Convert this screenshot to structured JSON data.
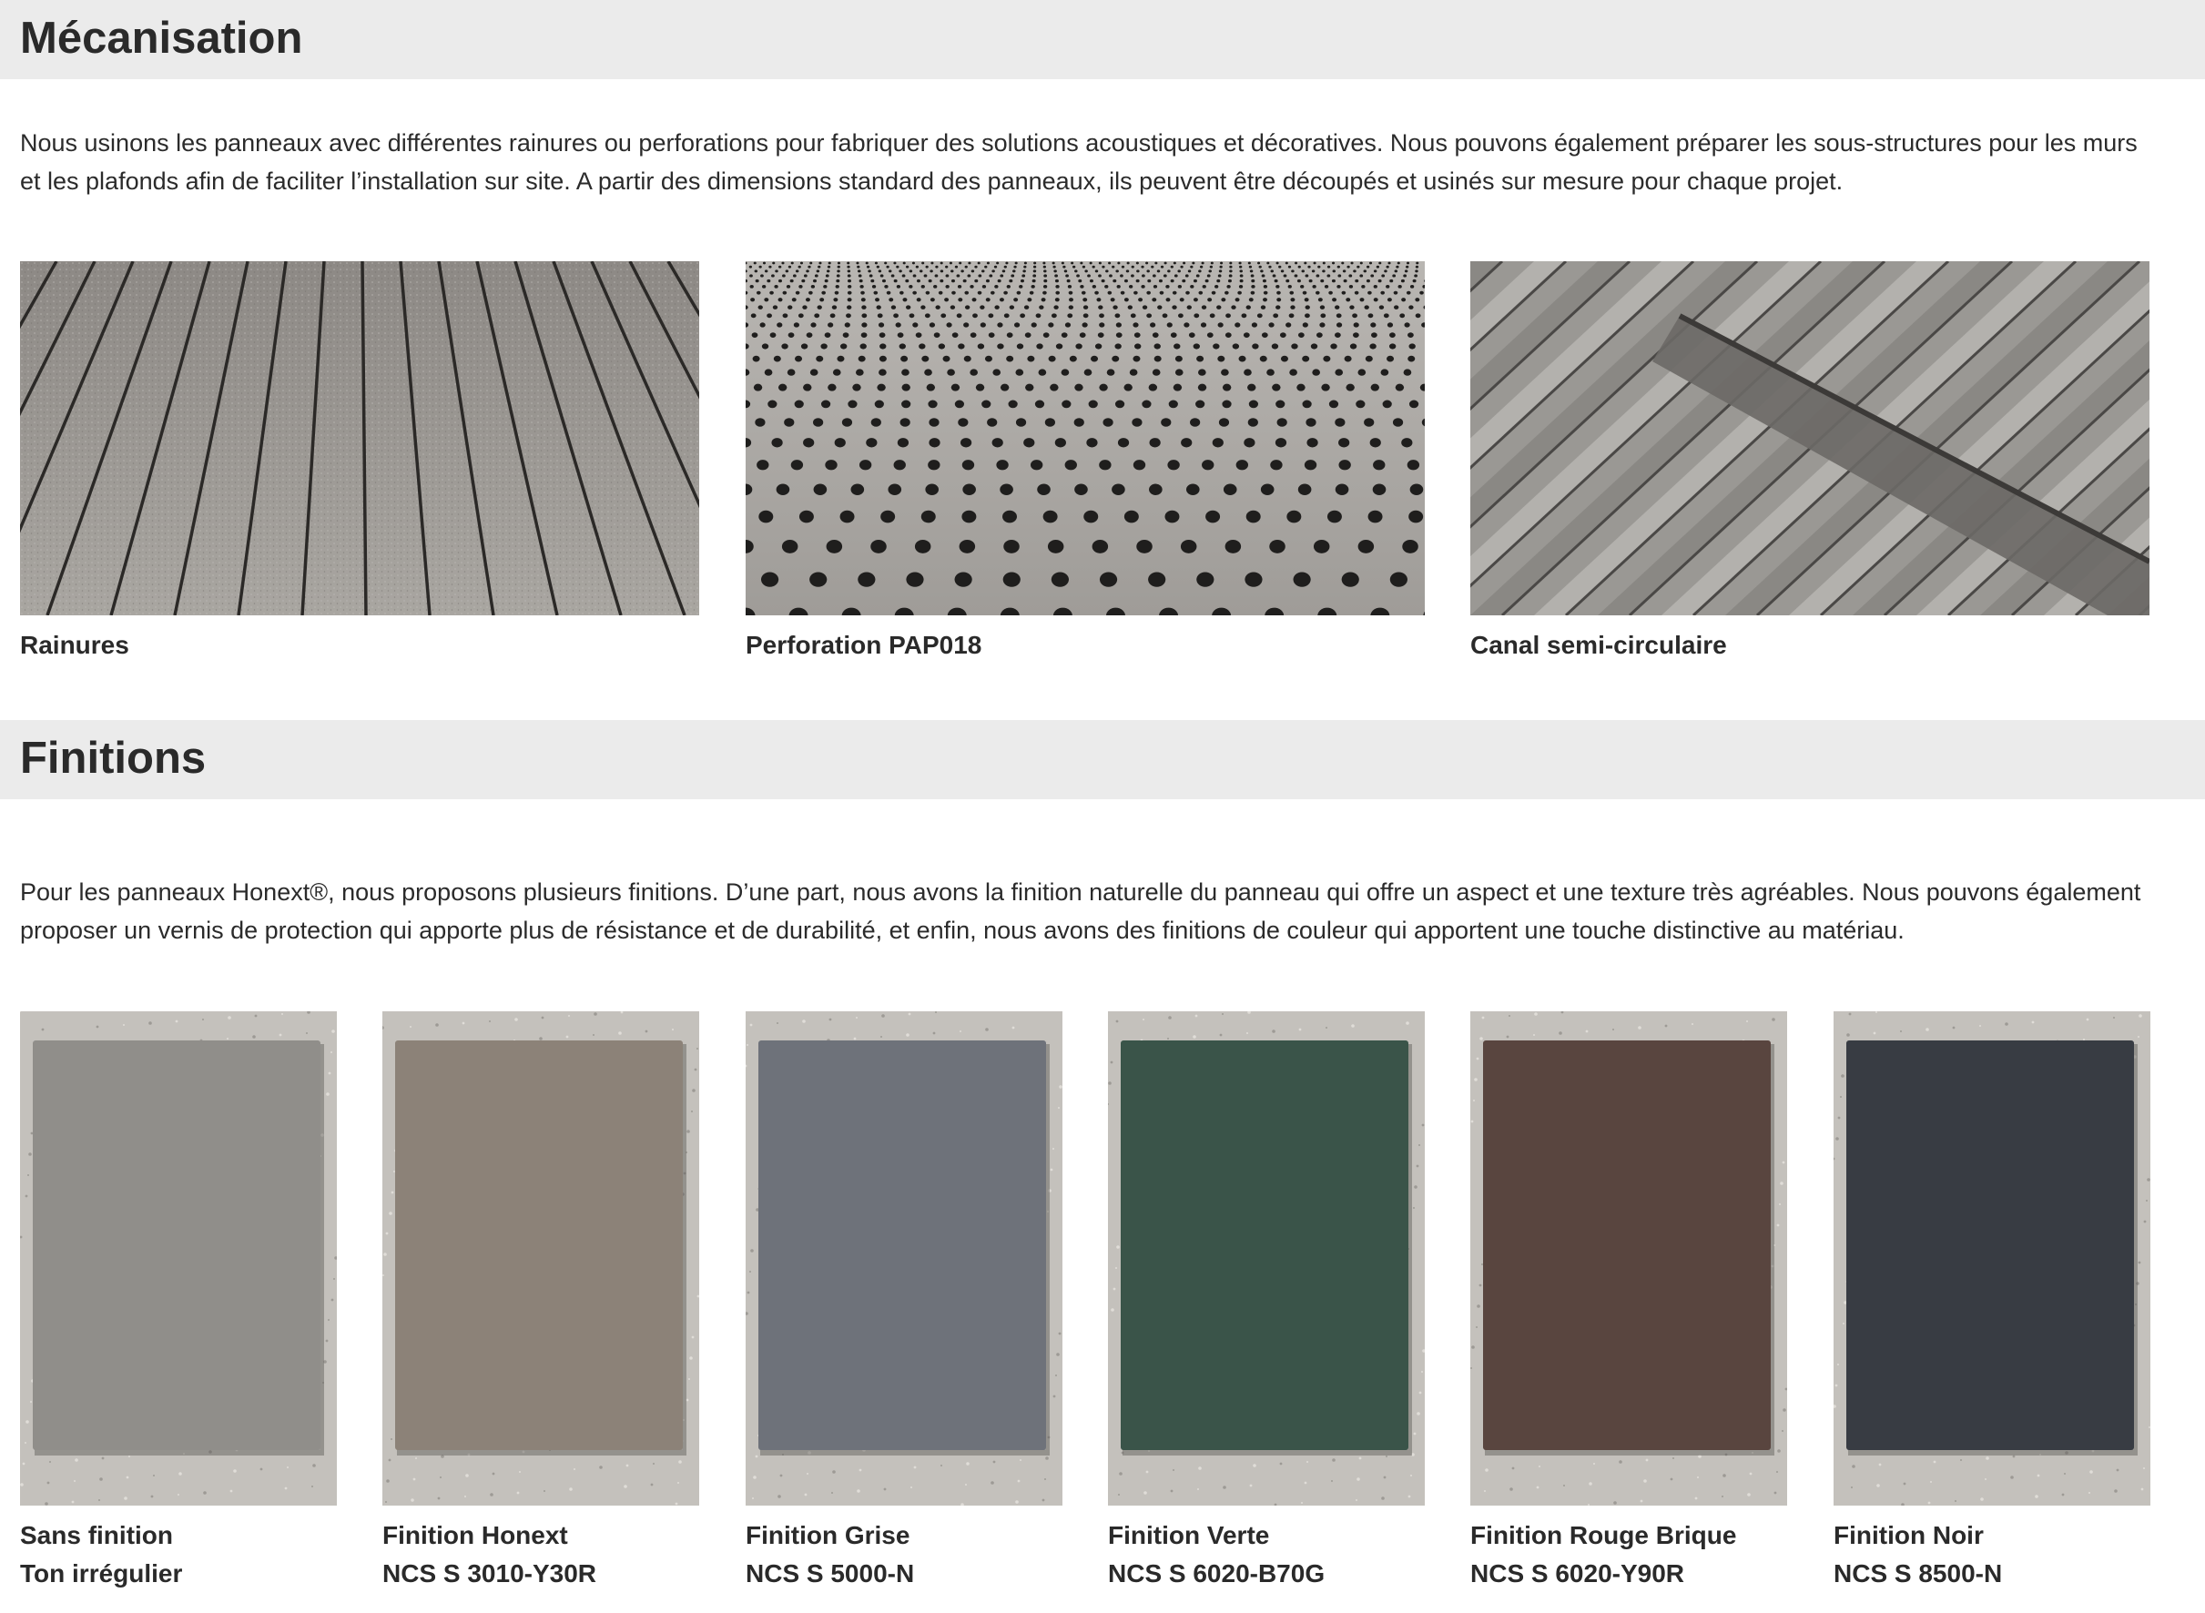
{
  "mecanisation": {
    "title": "Mécanisation",
    "intro": "Nous usinons les panneaux avec différentes rainures ou perforations pour fabriquer des solutions acoustiques et décoratives. Nous pouvons également préparer les sous-structures pour les murs et les plafonds afin de faciliter l’installation sur site. A partir des dimensions standard des panneaux, ils peuvent être découpés et usinés sur mesure pour chaque projet.",
    "items": [
      {
        "label": "Rainures"
      },
      {
        "label": "Perforation PAP018"
      },
      {
        "label": "Canal semi-circulaire"
      }
    ]
  },
  "finitions": {
    "title": "Finitions",
    "intro": "Pour les panneaux Honext®, nous proposons plusieurs finitions. D’une part, nous avons la finition naturelle du panneau qui offre un aspect et une texture très agréables. Nous pouvons également proposer un vernis de protection qui apporte plus de résistance et de durabilité, et enfin, nous avons des finitions de couleur qui apportent une touche distinctive au matériau.",
    "items": [
      {
        "label": "Sans finition",
        "code": "Ton irrégulier",
        "color": "#8a8783"
      },
      {
        "label": "Finition Honext",
        "code": "NCS S 3010-Y30R",
        "color": "#857b70"
      },
      {
        "label": "Finition Grise",
        "code": "NCS S 5000-N",
        "color": "#656a72"
      },
      {
        "label": "Finition Verte",
        "code": "NCS S 6020-B70G",
        "color": "#2e4a3e"
      },
      {
        "label": "Finition Rouge Brique",
        "code": "NCS S 6020-Y90R",
        "color": "#4f3a33"
      },
      {
        "label": "Finition Noir",
        "code": "NCS S 8500-N",
        "color": "#2c3038"
      }
    ]
  }
}
